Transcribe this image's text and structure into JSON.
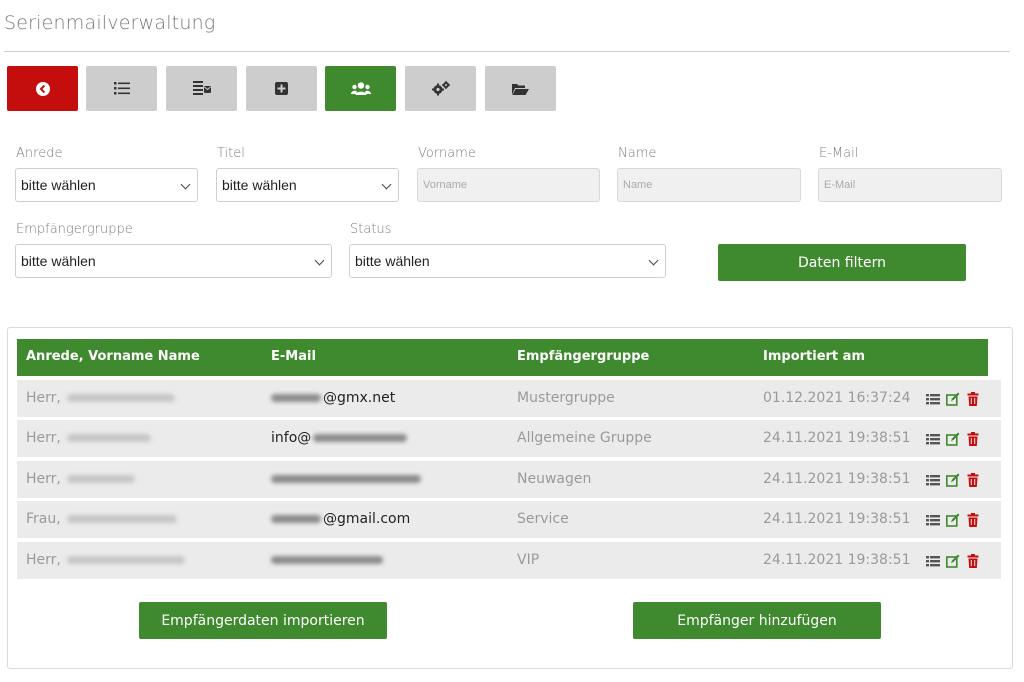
{
  "page": {
    "title": "Serienmailverwaltung"
  },
  "toolbar": {
    "buttons": [
      {
        "icon": "back-circle-icon",
        "color": "#c40e0e"
      },
      {
        "icon": "list-icon",
        "color": "#cdcdcd"
      },
      {
        "icon": "mail-stack-icon",
        "color": "#cdcdcd"
      },
      {
        "icon": "plus-square-icon",
        "color": "#cdcdcd"
      },
      {
        "icon": "users-icon",
        "color": "#3f8a2e"
      },
      {
        "icon": "gears-icon",
        "color": "#cdcdcd"
      },
      {
        "icon": "folder-open-icon",
        "color": "#cdcdcd"
      }
    ]
  },
  "filters": {
    "anrede": {
      "label": "Anrede",
      "value": "bitte wählen"
    },
    "titel": {
      "label": "Titel",
      "value": "bitte wählen"
    },
    "vorname": {
      "label": "Vorname",
      "placeholder": "Vorname"
    },
    "name": {
      "label": "Name",
      "placeholder": "Name"
    },
    "email": {
      "label": "E-Mail",
      "placeholder": "E-Mail"
    },
    "gruppe": {
      "label": "Empfängergruppe",
      "value": "bitte wählen"
    },
    "status": {
      "label": "Status",
      "value": "bitte wählen"
    },
    "submit_label": "Daten filtern"
  },
  "table": {
    "headers": [
      "Anrede, Vorname Name",
      "E-Mail",
      "Empfängergruppe",
      "Importiert am"
    ],
    "rows": [
      {
        "anrede": "Herr,",
        "email_visible": "@gmx.net",
        "gruppe": "Mustergruppe",
        "importiert": "01.12.2021 16:37:24"
      },
      {
        "anrede": "Herr,",
        "email_visible": "info@",
        "gruppe": "Allgemeine Gruppe",
        "importiert": "24.11.2021 19:38:51"
      },
      {
        "anrede": "Herr,",
        "email_visible": "",
        "gruppe": "Neuwagen",
        "importiert": "24.11.2021 19:38:51"
      },
      {
        "anrede": "Frau,",
        "email_visible": "@gmail.com",
        "gruppe": "Service",
        "importiert": "24.11.2021 19:38:51"
      },
      {
        "anrede": "Herr,",
        "email_visible": "",
        "gruppe": "VIP",
        "importiert": "24.11.2021 19:38:51"
      }
    ]
  },
  "actions": {
    "import_label": "Empfängerdaten importieren",
    "add_label": "Empfänger hinzufügen"
  },
  "colors": {
    "accent": "#3f8a2e",
    "danger": "#c40e0e",
    "toolbar_grey": "#cdcdcd"
  }
}
